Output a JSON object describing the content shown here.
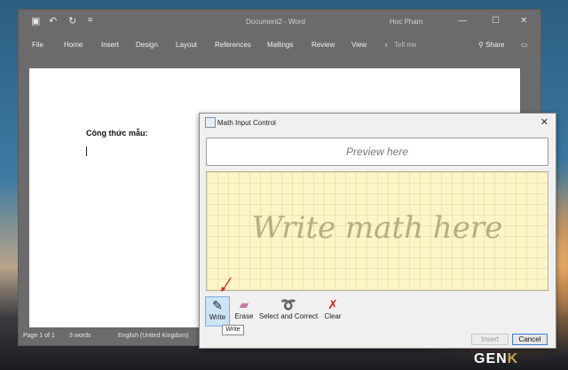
{
  "word": {
    "title": "Document2 - Word",
    "user": "Hoc Pham",
    "tabs": [
      "File",
      "Home",
      "Insert",
      "Design",
      "Layout",
      "References",
      "Mailings",
      "Review",
      "View",
      "Tell me"
    ],
    "share": "Share",
    "heading": "Công thức mẫu:",
    "status": {
      "page": "Page 1 of 1",
      "words": "3 words",
      "language": "English (United Kingdom)"
    }
  },
  "mic": {
    "title": "Math Input Control",
    "preview_placeholder": "Preview here",
    "pad_placeholder": "Write math here",
    "tools": {
      "write": "Write",
      "erase": "Erase",
      "select": "Select and Correct",
      "clear": "Clear"
    },
    "tooltip": "Write",
    "insert": "Insert",
    "cancel": "Cancel"
  },
  "logo": {
    "main": "GEN",
    "accent": "K"
  },
  "colors": {
    "word_bg": "#6b6b6b",
    "pad_bg": "#fdf4c8",
    "accent": "#3a7ed1",
    "clear_red": "#d22"
  }
}
